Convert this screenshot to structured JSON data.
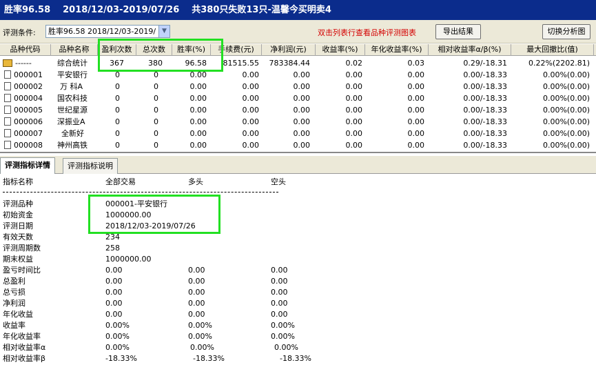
{
  "title": {
    "winrate": "胜率96.58",
    "period": "2018/12/03-2019/07/26",
    "summary": "共380只失败13只-温馨今买明卖4"
  },
  "toolbar": {
    "label": "评测条件:",
    "select_value": "胜率96.58  2018/12/03-2019/",
    "hint": "双击列表行查看品种评测图表",
    "export_label": "导出结果",
    "switch_label": "切换分析图"
  },
  "grid": {
    "headers": [
      "品种代码",
      "品种名称",
      "盈利次数",
      "总次数",
      "胜率(%)",
      "手续费(元)",
      "净利润(元)",
      "收益率(%)",
      "年化收益率(%)",
      "相对收益率α/β(%)",
      "最大回撤比(值)"
    ],
    "rows": [
      {
        "code": "------",
        "name": "综合统计",
        "wins": "367",
        "total": "380",
        "rate": "96.58",
        "fee": "81515.55",
        "profit": "783384.44",
        "ret": "0.02",
        "annual": "0.03",
        "rel": "0.29/-18.31",
        "dd": "0.22%(2202.81)"
      },
      {
        "code": "000001",
        "name": "平安银行",
        "wins": "0",
        "total": "0",
        "rate": "0.00",
        "fee": "0.00",
        "profit": "0.00",
        "ret": "0.00",
        "annual": "0.00",
        "rel": "0.00/-18.33",
        "dd": "0.00%(0.00)"
      },
      {
        "code": "000002",
        "name": "万 科A",
        "wins": "0",
        "total": "0",
        "rate": "0.00",
        "fee": "0.00",
        "profit": "0.00",
        "ret": "0.00",
        "annual": "0.00",
        "rel": "0.00/-18.33",
        "dd": "0.00%(0.00)"
      },
      {
        "code": "000004",
        "name": "国农科技",
        "wins": "0",
        "total": "0",
        "rate": "0.00",
        "fee": "0.00",
        "profit": "0.00",
        "ret": "0.00",
        "annual": "0.00",
        "rel": "0.00/-18.33",
        "dd": "0.00%(0.00)"
      },
      {
        "code": "000005",
        "name": "世纪星源",
        "wins": "0",
        "total": "0",
        "rate": "0.00",
        "fee": "0.00",
        "profit": "0.00",
        "ret": "0.00",
        "annual": "0.00",
        "rel": "0.00/-18.33",
        "dd": "0.00%(0.00)"
      },
      {
        "code": "000006",
        "name": "深振业A",
        "wins": "0",
        "total": "0",
        "rate": "0.00",
        "fee": "0.00",
        "profit": "0.00",
        "ret": "0.00",
        "annual": "0.00",
        "rel": "0.00/-18.33",
        "dd": "0.00%(0.00)"
      },
      {
        "code": "000007",
        "name": "全新好",
        "wins": "0",
        "total": "0",
        "rate": "0.00",
        "fee": "0.00",
        "profit": "0.00",
        "ret": "0.00",
        "annual": "0.00",
        "rel": "0.00/-18.33",
        "dd": "0.00%(0.00)"
      },
      {
        "code": "000008",
        "name": "神州高铁",
        "wins": "0",
        "total": "0",
        "rate": "0.00",
        "fee": "0.00",
        "profit": "0.00",
        "ret": "0.00",
        "annual": "0.00",
        "rel": "0.00/-18.33",
        "dd": "0.00%(0.00)"
      }
    ]
  },
  "tabs": [
    "评测指标详情",
    "评测指标说明"
  ],
  "detail": {
    "headers": {
      "name": "指标名称",
      "all": "全部交易",
      "long": "多头",
      "short": "空头"
    },
    "rows": [
      {
        "name": "评测品种",
        "all": "000001-平安银行",
        "long": "",
        "short": ""
      },
      {
        "name": "初始资金",
        "all": "1000000.00",
        "long": "",
        "short": ""
      },
      {
        "name": "评测日期",
        "all": "2018/12/03-2019/07/26",
        "long": "",
        "short": ""
      },
      {
        "name": "有效天数",
        "all": "234",
        "long": "",
        "short": ""
      },
      {
        "name": "评测周期数",
        "all": "258",
        "long": "",
        "short": ""
      },
      {
        "name": "期末权益",
        "all": "1000000.00",
        "long": "",
        "short": ""
      },
      {
        "name": "盈亏时间比",
        "all": "0.00",
        "long": "0.00",
        "short": "0.00"
      },
      {
        "name": "总盈利",
        "all": "0.00",
        "long": "0.00",
        "short": "0.00"
      },
      {
        "name": "总亏损",
        "all": "0.00",
        "long": "0.00",
        "short": "0.00"
      },
      {
        "name": "净利润",
        "all": "0.00",
        "long": "0.00",
        "short": "0.00"
      },
      {
        "name": "年化收益",
        "all": "0.00",
        "long": "0.00",
        "short": "0.00"
      },
      {
        "name": "收益率",
        "all": "0.00%",
        "long": "0.00%",
        "short": "0.00%"
      },
      {
        "name": "年化收益率",
        "all": "0.00%",
        "long": "0.00%",
        "short": "0.00%"
      },
      {
        "name": "相对收益率α",
        "all": "0.00%",
        "long": "0.00%",
        "short": "0.00%"
      },
      {
        "name": "相对收益率β",
        "all": "-18.33%",
        "long": "-18.33%",
        "short": "-18.33%"
      }
    ]
  },
  "colors": {
    "title_bg": "#0b2c8c",
    "hint": "#d40000",
    "highlight": "#22e022"
  }
}
